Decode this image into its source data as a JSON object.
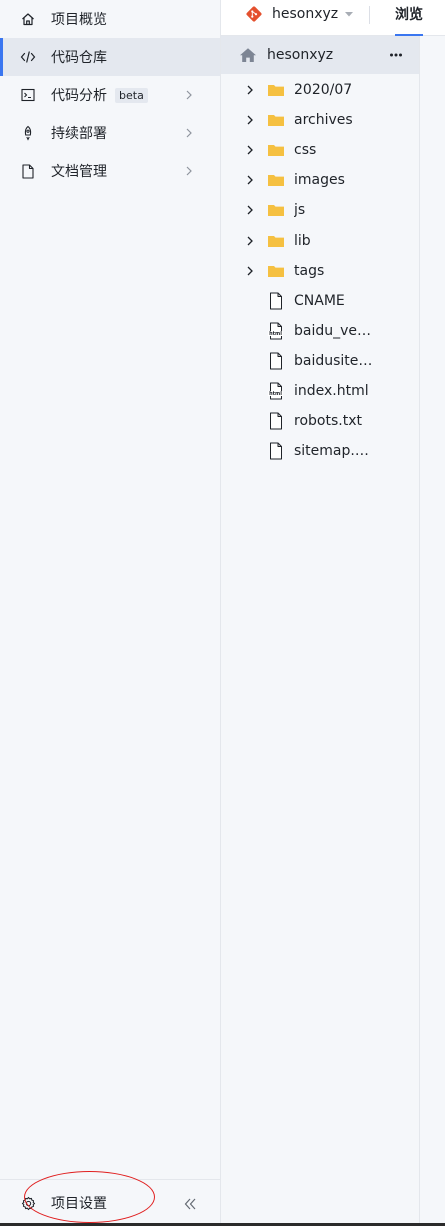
{
  "sidebar": {
    "items": [
      {
        "label": "项目概览",
        "icon": "home-icon",
        "active": false,
        "has_arrow": false
      },
      {
        "label": "代码仓库",
        "icon": "code-icon",
        "active": true,
        "has_arrow": false
      },
      {
        "label": "代码分析",
        "icon": "terminal-icon",
        "active": false,
        "has_arrow": true,
        "badge": "beta"
      },
      {
        "label": "持续部署",
        "icon": "rocket-icon",
        "active": false,
        "has_arrow": true
      },
      {
        "label": "文档管理",
        "icon": "document-icon",
        "active": false,
        "has_arrow": true
      }
    ],
    "footer": {
      "label": "项目设置",
      "icon": "gear-icon",
      "collapse_icon": "double-chevron-left-icon"
    }
  },
  "topbar": {
    "repo_name": "hesonxyz",
    "repo_icon": "git-logo-icon",
    "active_tab": "浏览"
  },
  "tree": {
    "root_label": "hesonxyz",
    "root_icon": "home-icon",
    "items": [
      {
        "name": "2020/07",
        "type": "folder"
      },
      {
        "name": "archives",
        "type": "folder"
      },
      {
        "name": "css",
        "type": "folder"
      },
      {
        "name": "images",
        "type": "folder"
      },
      {
        "name": "js",
        "type": "folder"
      },
      {
        "name": "lib",
        "type": "folder"
      },
      {
        "name": "tags",
        "type": "folder"
      },
      {
        "name": "CNAME",
        "type": "file"
      },
      {
        "name": "baidu_verif...",
        "type": "html"
      },
      {
        "name": "baidusitem...",
        "type": "file"
      },
      {
        "name": "index.html",
        "type": "html"
      },
      {
        "name": "robots.txt",
        "type": "file"
      },
      {
        "name": "sitemap.xml",
        "type": "file"
      }
    ]
  },
  "colors": {
    "accent": "#3a76f0",
    "folder": "#f5c041",
    "git": "#e4502e",
    "annotation": "#e02020"
  }
}
